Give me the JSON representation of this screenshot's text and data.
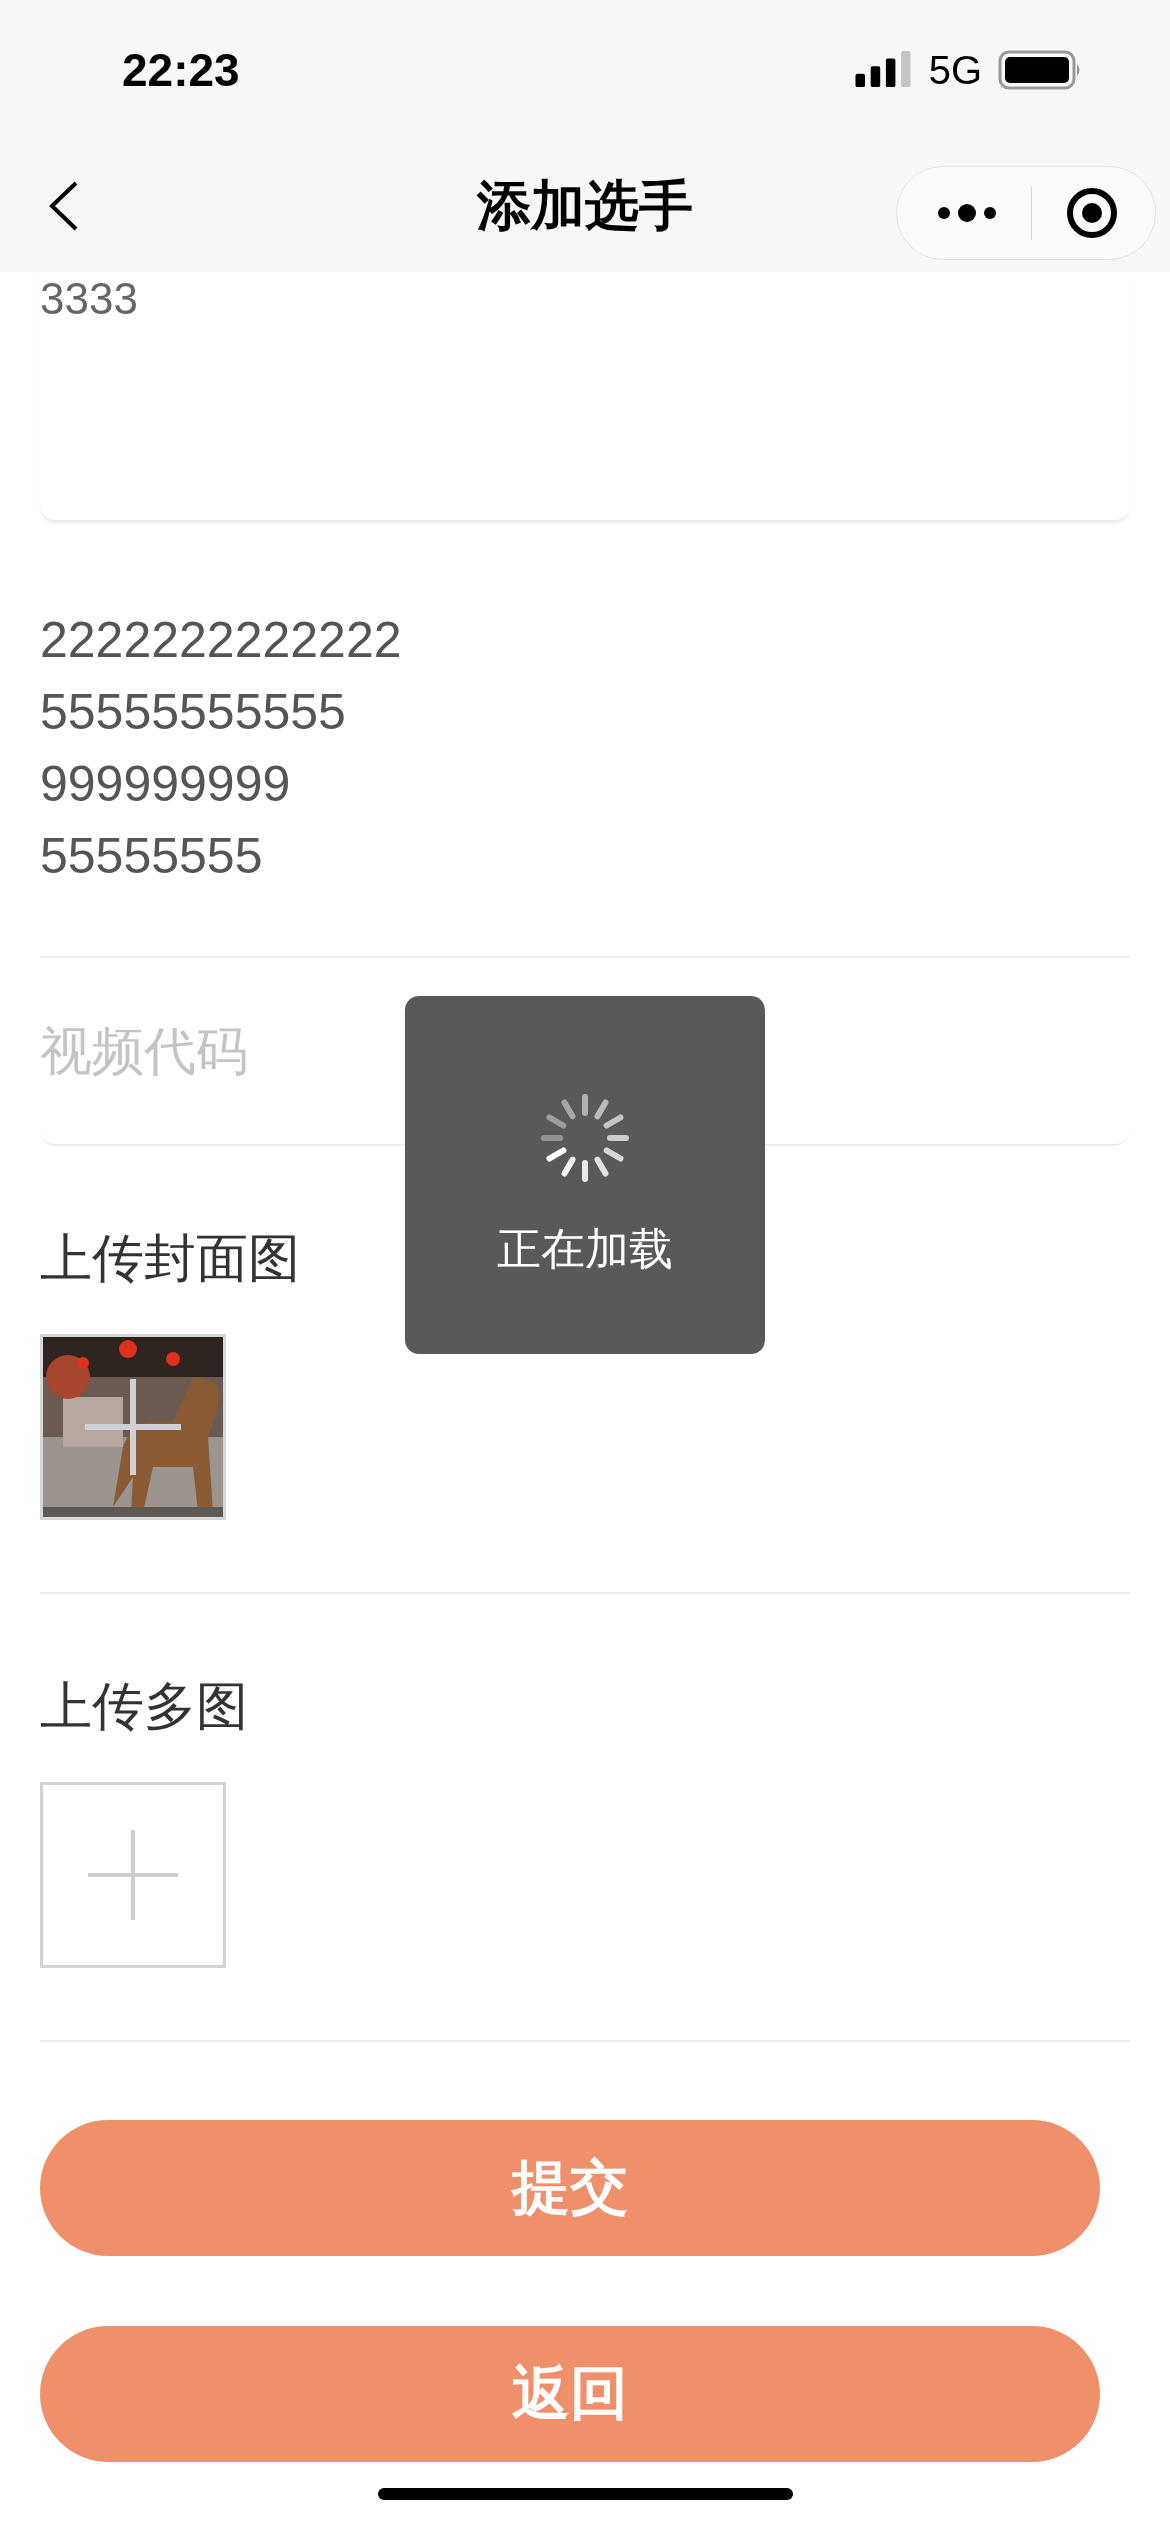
{
  "status_bar": {
    "time": "22:23",
    "network": "5G"
  },
  "nav": {
    "title": "添加选手"
  },
  "form": {
    "textarea_value": "3333",
    "text_lines": [
      "2222222222222",
      "55555555555",
      "999999999",
      "55555555"
    ],
    "video_field": {
      "placeholder": "视频代码"
    },
    "cover": {
      "label": "上传封面图"
    },
    "gallery": {
      "label": "上传多图"
    }
  },
  "buttons": [
    {
      "label": "提交"
    },
    {
      "label": "返回"
    }
  ],
  "toast": {
    "text": "正在加载"
  }
}
